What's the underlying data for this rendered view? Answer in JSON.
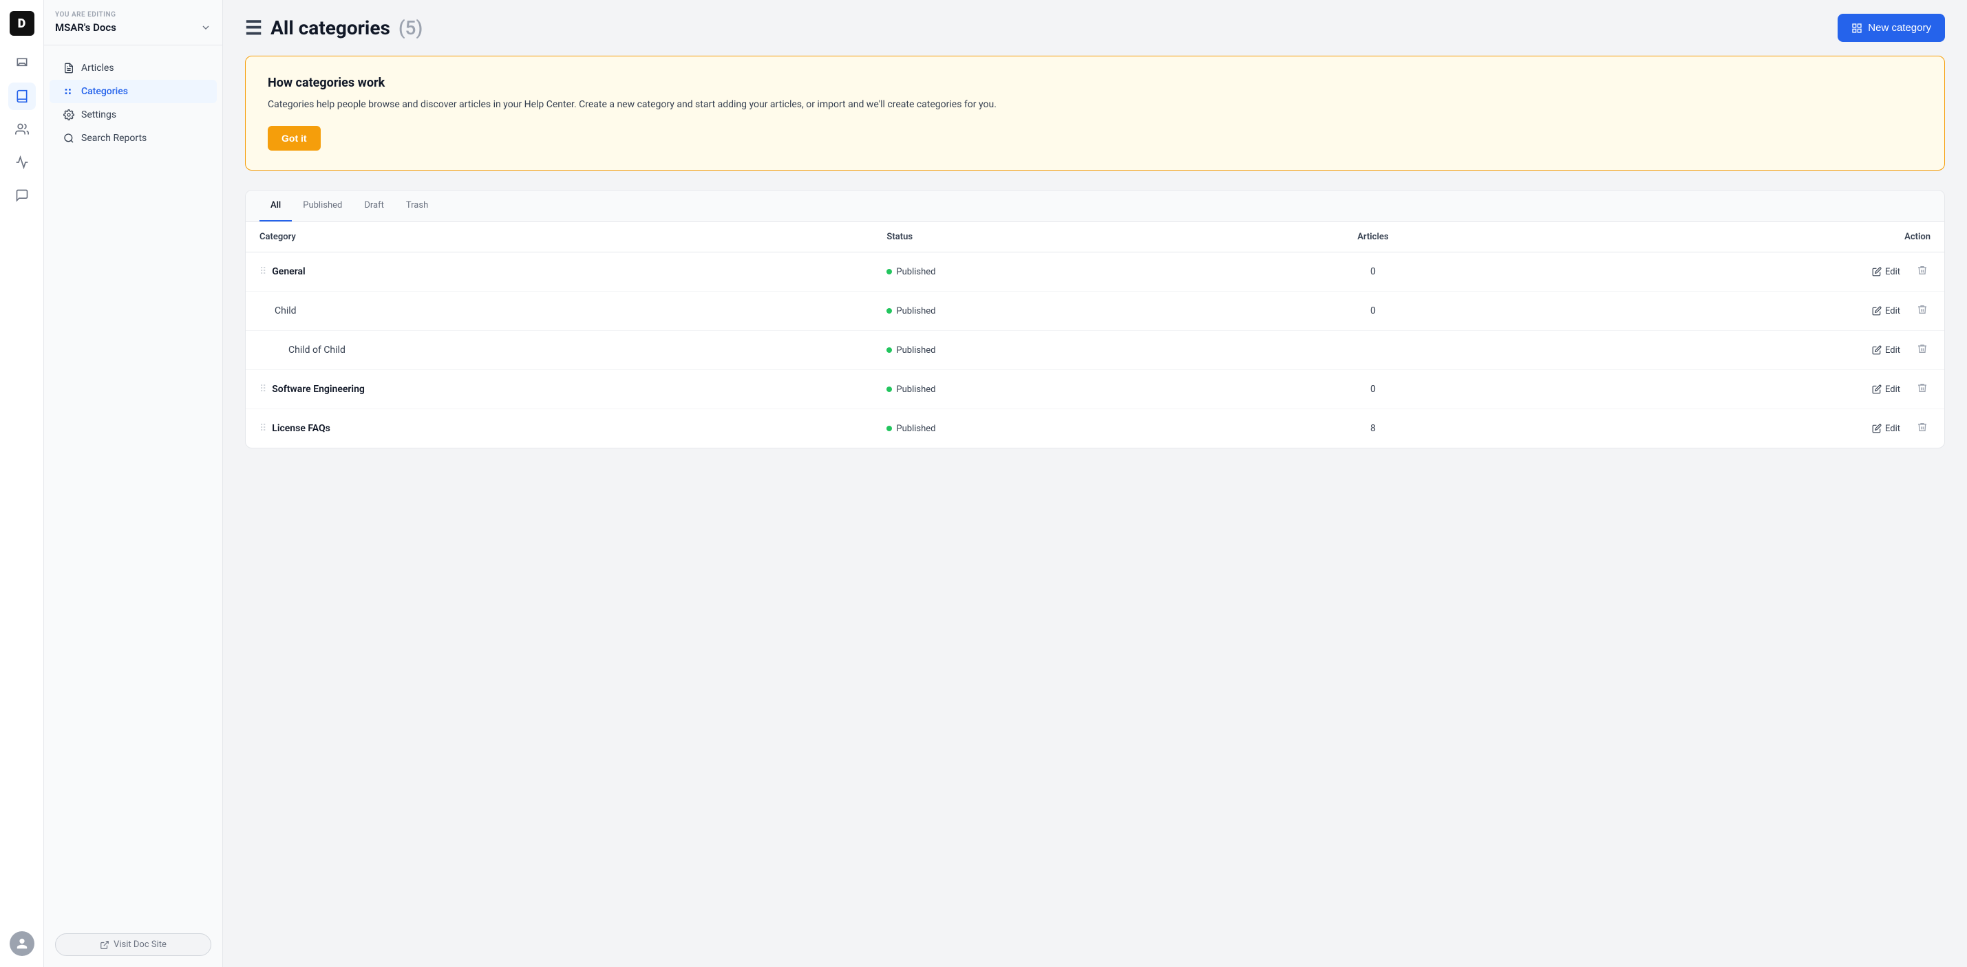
{
  "app": {
    "logo": "D",
    "workspace_label": "YOU ARE EDITING",
    "workspace_name": "MSAR's Docs"
  },
  "icon_nav": [
    {
      "name": "inbox-icon",
      "label": "Inbox"
    },
    {
      "name": "book-icon",
      "label": "Knowledge Base",
      "active": true
    },
    {
      "name": "users-icon",
      "label": "Users"
    },
    {
      "name": "activity-icon",
      "label": "Activity"
    },
    {
      "name": "chat-icon",
      "label": "Chat"
    }
  ],
  "sidebar": {
    "items": [
      {
        "id": "articles",
        "label": "Articles"
      },
      {
        "id": "categories",
        "label": "Categories",
        "active": true
      },
      {
        "id": "settings",
        "label": "Settings"
      },
      {
        "id": "search-reports",
        "label": "Search Reports"
      }
    ],
    "visit_btn": "Visit Doc Site"
  },
  "header": {
    "menu_label": "☰",
    "title": "All categories",
    "count": "(5)",
    "new_btn": "New category"
  },
  "info_box": {
    "title": "How categories work",
    "description": "Categories help people browse and discover articles in your Help Center. Create a new category and start adding your articles, or import and we'll create categories for you.",
    "got_it": "Got it"
  },
  "table": {
    "tabs": [
      "All",
      "Published",
      "Draft",
      "Trash"
    ],
    "active_tab": "All",
    "columns": {
      "category": "Category",
      "status": "Status",
      "articles": "Articles",
      "action": "Action"
    },
    "rows": [
      {
        "id": 1,
        "name": "General",
        "level": 0,
        "status": "Published",
        "articles": "0",
        "has_drag": true
      },
      {
        "id": 2,
        "name": "Child",
        "level": 1,
        "status": "Published",
        "articles": "0",
        "has_drag": false
      },
      {
        "id": 3,
        "name": "Child of Child",
        "level": 2,
        "status": "Published",
        "articles": "",
        "has_drag": false
      },
      {
        "id": 4,
        "name": "Software Engineering",
        "level": 0,
        "status": "Published",
        "articles": "0",
        "has_drag": true
      },
      {
        "id": 5,
        "name": "License FAQs",
        "level": 0,
        "status": "Published",
        "articles": "8",
        "has_drag": true
      }
    ],
    "edit_label": "Edit"
  }
}
